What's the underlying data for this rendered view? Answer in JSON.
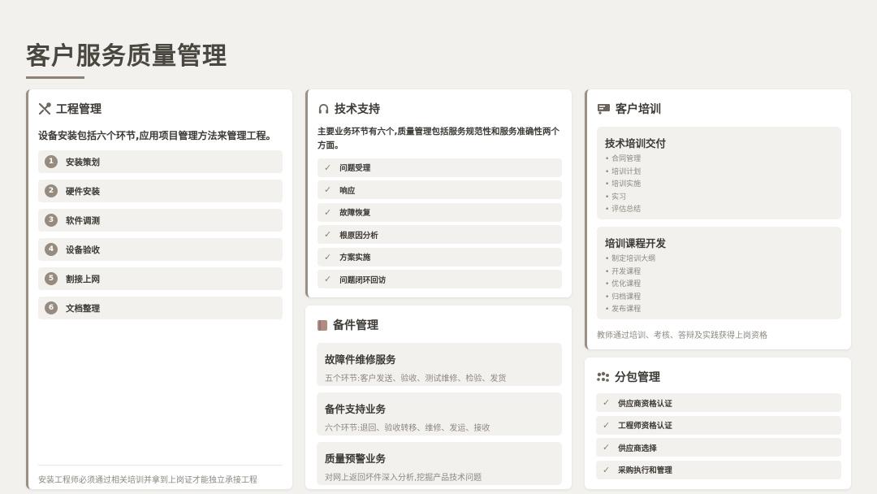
{
  "page": {
    "title": "客户服务质量管理"
  },
  "engineering": {
    "title": "工程管理",
    "intro": "设备安装包括六个环节,应用项目管理方法来管理工程。",
    "steps": [
      {
        "num": "1",
        "label": "安装策划"
      },
      {
        "num": "2",
        "label": "硬件安装"
      },
      {
        "num": "3",
        "label": "软件调测"
      },
      {
        "num": "4",
        "label": "设备验收"
      },
      {
        "num": "5",
        "label": "割接上网"
      },
      {
        "num": "6",
        "label": "文档整理"
      }
    ],
    "footer": "安装工程师必须通过相关培训并拿到上岗证才能独立承接工程"
  },
  "tech_support": {
    "title": "技术支持",
    "intro": "主要业务环节有六个,质量管理包括服务规范性和服务准确性两个方面。",
    "items": [
      "问题受理",
      "响应",
      "故障恢复",
      "根原因分析",
      "方案实施",
      "问题闭环回访"
    ]
  },
  "spare_parts": {
    "title": "备件管理",
    "blocks": [
      {
        "title": "故障件维修服务",
        "desc": "五个环节:客户发送、验收、测试维修、检验、发货"
      },
      {
        "title": "备件支持业务",
        "desc": "六个环节:退回、验收转移、维修、发运、接收"
      },
      {
        "title": "质量预警业务",
        "desc": "对网上返回坏件深入分析,挖掘产品技术问题"
      }
    ]
  },
  "training": {
    "title": "客户培训",
    "blocks": [
      {
        "title": "技术培训交付",
        "items": [
          "合同管理",
          "培训计划",
          "培训实施",
          "实习",
          "评估总结"
        ]
      },
      {
        "title": "培训课程开发",
        "items": [
          "制定培训大纲",
          "开发课程",
          "优化课程",
          "归档课程",
          "发布课程"
        ]
      }
    ],
    "footer": "教师通过培训、考核、答辩及实践获得上岗资格"
  },
  "subcontract": {
    "title": "分包管理",
    "items": [
      "供应商资格认证",
      "工程师资格认证",
      "供应商选择",
      "采购执行和管理"
    ]
  },
  "colors": {
    "accent": "#968b7e",
    "background": "#f3f1ee",
    "card": "#ffffff"
  }
}
